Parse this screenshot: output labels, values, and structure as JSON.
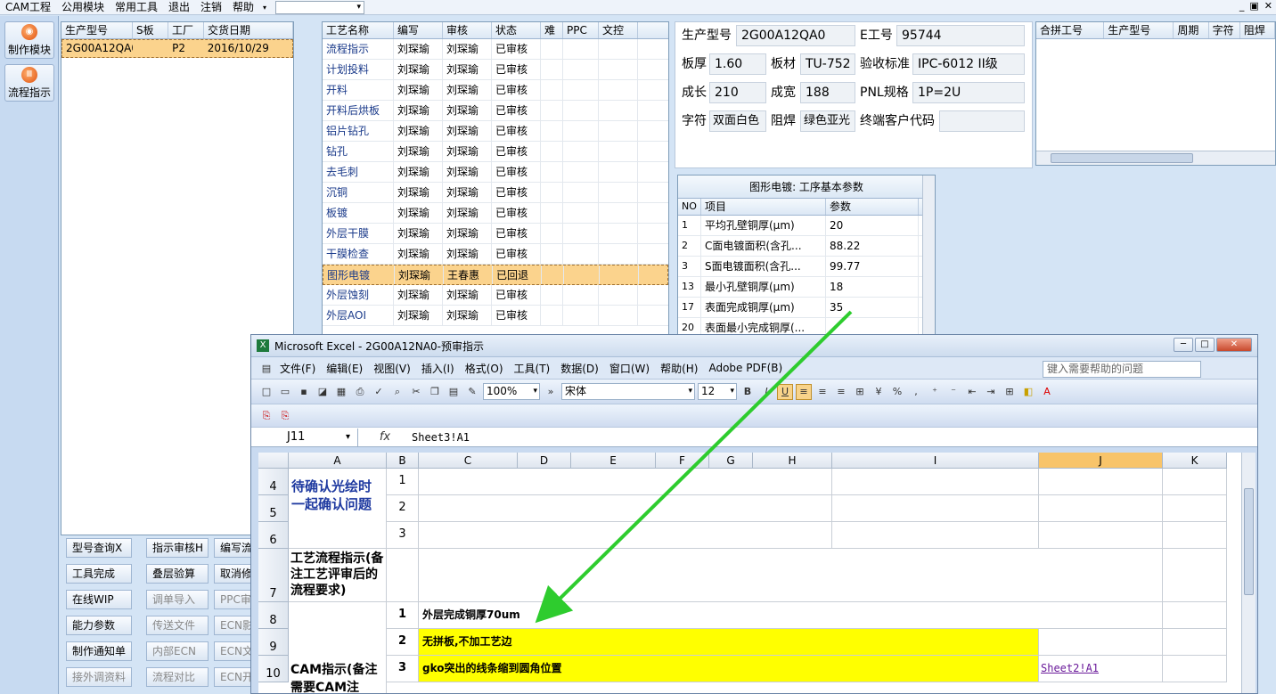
{
  "menubar": {
    "items": [
      "CAM工程",
      "公用模块",
      "常用工具",
      "退出",
      "注销",
      "帮助"
    ]
  },
  "leftbar": {
    "buttons": [
      "制作模块",
      "流程指示"
    ]
  },
  "orders": {
    "headers": [
      "生产型号",
      "S板",
      "工厂",
      "交货日期"
    ],
    "rows": [
      [
        "2G00A12QA0",
        "",
        "P2",
        "2016/10/29"
      ]
    ]
  },
  "process": {
    "headers": [
      "工艺名称",
      "编写",
      "审核",
      "状态",
      "难",
      "PPC",
      "文控"
    ],
    "rows": [
      [
        "流程指示",
        "刘琛瑜",
        "刘琛瑜",
        "已审核"
      ],
      [
        "计划投料",
        "刘琛瑜",
        "刘琛瑜",
        "已审核"
      ],
      [
        "开料",
        "刘琛瑜",
        "刘琛瑜",
        "已审核"
      ],
      [
        "开料后烘板",
        "刘琛瑜",
        "刘琛瑜",
        "已审核"
      ],
      [
        "铝片钻孔",
        "刘琛瑜",
        "刘琛瑜",
        "已审核"
      ],
      [
        "钻孔",
        "刘琛瑜",
        "刘琛瑜",
        "已审核"
      ],
      [
        "去毛刺",
        "刘琛瑜",
        "刘琛瑜",
        "已审核"
      ],
      [
        "沉铜",
        "刘琛瑜",
        "刘琛瑜",
        "已审核"
      ],
      [
        "板镀",
        "刘琛瑜",
        "刘琛瑜",
        "已审核"
      ],
      [
        "外层干膜",
        "刘琛瑜",
        "刘琛瑜",
        "已审核"
      ],
      [
        "干膜检查",
        "刘琛瑜",
        "刘琛瑜",
        "已审核"
      ],
      [
        "图形电镀",
        "刘琛瑜",
        "王春惠",
        "已回退"
      ],
      [
        "外层蚀刻",
        "刘琛瑜",
        "刘琛瑜",
        "已审核"
      ],
      [
        "外层AOI",
        "刘琛瑜",
        "刘琛瑜",
        "已审核"
      ]
    ]
  },
  "info": {
    "model_label": "生产型号",
    "model": "2G00A12QA0",
    "eno_label": "E工号",
    "eno": "95744",
    "thick_label": "板厚",
    "thick": "1.60",
    "mat_label": "板材",
    "mat": "TU-752",
    "std_label": "验收标准",
    "std": "IPC-6012 II级",
    "len_label": "成长",
    "len": "210",
    "wid_label": "成宽",
    "wid": "188",
    "pnl_label": "PNL规格",
    "pnl": "1P=2U",
    "char_label": "字符",
    "char": "双面白色",
    "mask_label": "阻焊",
    "mask": "绿色亚光",
    "cust_label": "终端客户代码",
    "cust": ""
  },
  "merge": {
    "headers": [
      "合拼工号",
      "生产型号",
      "周期",
      "字符",
      "阻焊"
    ]
  },
  "params": {
    "title": "图形电镀: 工序基本参数",
    "headers": [
      "NO",
      "项目",
      "参数"
    ],
    "rows": [
      [
        "1",
        "平均孔壁铜厚(μm)",
        "20"
      ],
      [
        "2",
        "C面电镀面积(含孔...",
        "88.22"
      ],
      [
        "3",
        "S面电镀面积(含孔...",
        "99.77"
      ],
      [
        "13",
        "最小孔壁铜厚(μm)",
        "18"
      ],
      [
        "17",
        "表面完成铜厚(μm)",
        "35"
      ],
      [
        "20",
        "表面最小完成铜厚(...",
        ""
      ]
    ]
  },
  "bottom_buttons": [
    [
      "型号查询X",
      "指示审核H",
      "编写流"
    ],
    [
      "工具完成",
      "叠层验算",
      "取消修"
    ],
    [
      "在线WIP",
      "调单导入",
      "PPC审"
    ],
    [
      "能力参数",
      "传送文件",
      "ECN影"
    ],
    [
      "制作通知单",
      "内部ECN",
      "ECN文"
    ],
    [
      "接外调资料",
      "流程对比",
      "ECN开"
    ]
  ],
  "excel": {
    "title": "Microsoft Excel - 2G00A12NA0-预审指示",
    "menu": [
      "文件(F)",
      "编辑(E)",
      "视图(V)",
      "插入(I)",
      "格式(O)",
      "工具(T)",
      "数据(D)",
      "窗口(W)",
      "帮助(H)",
      "Adobe PDF(B)"
    ],
    "help_placeholder": "键入需要帮助的问题",
    "zoom": "100%",
    "font": "宋体",
    "size": "12",
    "namebox": "J11",
    "formula": "Sheet3!A1",
    "cols": [
      "A",
      "B",
      "C",
      "D",
      "E",
      "F",
      "G",
      "H",
      "I",
      "J",
      "K"
    ],
    "rows": [
      "4",
      "5",
      "6",
      "7",
      "8",
      "9",
      "10"
    ],
    "cellA1": "待确认光绘时一起确认问题",
    "cellA2": "工艺流程指示(备注工艺评审后的流程要求)",
    "cellA3": "CAM指示(备注需要CAM注",
    "b": [
      "1",
      "2",
      "3",
      "1",
      "2",
      "3"
    ],
    "c8": "外层完成铜厚70um",
    "c9": "无拼板,不加工艺边",
    "c10": "gko突出的线条缩到圆角位置",
    "j10": "Sheet2!A1",
    "highlight": "#ffff00",
    "arrow": "#2ecc2e"
  }
}
